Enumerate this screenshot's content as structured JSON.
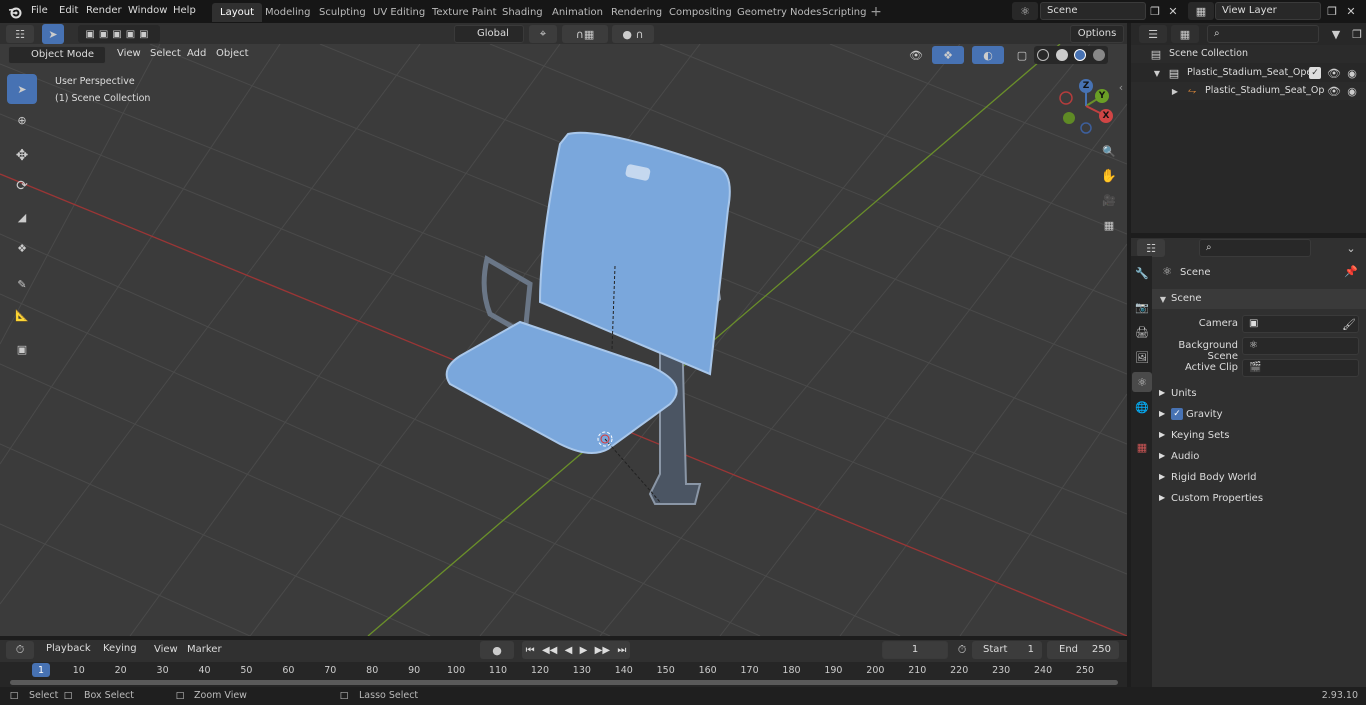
{
  "menu": {
    "file": "File",
    "edit": "Edit",
    "render": "Render",
    "window": "Window",
    "help": "Help"
  },
  "workspaces": [
    "Layout",
    "Modeling",
    "Sculpting",
    "UV Editing",
    "Texture Paint",
    "Shading",
    "Animation",
    "Rendering",
    "Compositing",
    "Geometry Nodes",
    "Scripting"
  ],
  "scene_field": "Scene",
  "view_layer_field": "View Layer",
  "viewport": {
    "mode": "Object Mode",
    "view": "View",
    "select": "Select",
    "add": "Add",
    "object": "Object",
    "orientation": "Global",
    "options": "Options",
    "overlay_title": "User Perspective",
    "overlay_sub": "(1) Scene Collection"
  },
  "gizmo": {
    "x": "X",
    "y": "Y",
    "z": "Z"
  },
  "outliner": {
    "root": "Scene Collection",
    "item1": "Plastic_Stadium_Seat_Open",
    "item2": "Plastic_Stadium_Seat_Op"
  },
  "properties": {
    "title": "Scene",
    "section": "Scene",
    "camera_label": "Camera",
    "bg_label": "Background Scene",
    "clip_label": "Active Clip",
    "units": "Units",
    "gravity": "Gravity",
    "keying": "Keying Sets",
    "audio": "Audio",
    "rigid": "Rigid Body World",
    "custom": "Custom Properties"
  },
  "timeline": {
    "playback": "Playback",
    "keying": "Keying",
    "view": "View",
    "marker": "Marker",
    "current": "1",
    "start_label": "Start",
    "start": "1",
    "end_label": "End",
    "end": "250",
    "ticks": [
      "1",
      "10",
      "20",
      "30",
      "40",
      "50",
      "60",
      "70",
      "80",
      "90",
      "100",
      "110",
      "120",
      "130",
      "140",
      "150",
      "160",
      "170",
      "180",
      "190",
      "200",
      "210",
      "220",
      "230",
      "240",
      "250"
    ]
  },
  "status": {
    "select": "Select",
    "box": "Box Select",
    "zoom": "Zoom View",
    "lasso": "Lasso Select",
    "version": "2.93.10"
  },
  "colors": {
    "accent": "#4772b3",
    "axis_x": "#9b3535",
    "axis_y": "#6a8f2a",
    "seat": "#7aa7dc"
  }
}
